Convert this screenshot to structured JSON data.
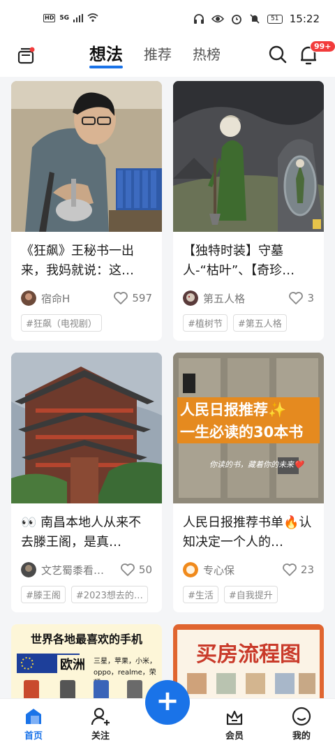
{
  "status_bar": {
    "hd": "HD",
    "network": "5G",
    "battery": "51",
    "time": "15:22"
  },
  "top_nav": {
    "tabs": [
      {
        "label": "想法"
      },
      {
        "label": "推荐"
      },
      {
        "label": "热榜"
      }
    ],
    "notification_badge": "99+"
  },
  "cards": [
    {
      "title": "《狂飙》王秘书一出来，我妈就说：这…",
      "author": "宿命H",
      "likes": "597",
      "tags": [
        "#狂飙（电视剧）"
      ]
    },
    {
      "title": "【独特时装】守墓人-“枯叶”、【奇珍…",
      "author": "第五人格",
      "likes": "3",
      "tags": [
        "#植树节",
        "#第五人格"
      ]
    },
    {
      "title": "👀 南昌本地人从来不去滕王阁，是真…",
      "author": "文艺蜀黍看…",
      "likes": "50",
      "tags": [
        "#滕王阁",
        "#2023想去的…"
      ]
    },
    {
      "title": "人民日报推荐书单🔥认知决定一个人的…",
      "author": "专心保",
      "likes": "23",
      "tags": [
        "#生活",
        "#自我提升"
      ]
    }
  ],
  "card_images": {
    "book_line1": "人民日报推荐✨",
    "book_line2": "一生必读的30本书",
    "book_sub": "你读的书，藏着你的未来❤️",
    "phone_title": "世界各地最喜欢的手机",
    "phone_region": "欧洲",
    "phone_brands1": "三星，苹果，小米，",
    "phone_brands2": "oppo，realme，荣耀",
    "house_title": "买房流程图"
  },
  "bottom_nav": {
    "items": [
      {
        "label": "首页"
      },
      {
        "label": "关注"
      },
      {
        "label": "会员"
      },
      {
        "label": "我的"
      }
    ],
    "fab_label": "+"
  },
  "colors": {
    "accent": "#1a73e8",
    "badge": "#f23b3b"
  }
}
